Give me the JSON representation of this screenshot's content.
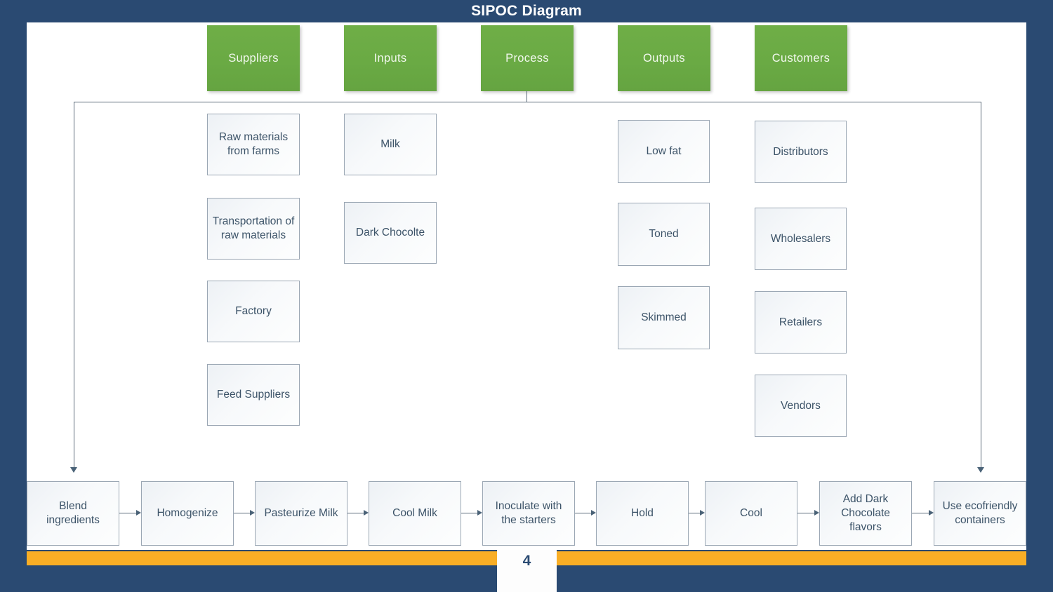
{
  "slide": {
    "title": "SIPOC Diagram",
    "page_number": "4",
    "colors": {
      "background": "#2A4A72",
      "canvas": "#FFFFFF",
      "header_green": "#6AAA44",
      "accent_orange": "#F9AE25",
      "card_border": "#9BA7B4",
      "card_text": "#3C5368",
      "connector": "#5C6B7A"
    }
  },
  "headers": [
    {
      "label": "Suppliers"
    },
    {
      "label": "Inputs"
    },
    {
      "label": "Process"
    },
    {
      "label": "Outputs"
    },
    {
      "label": "Customers"
    }
  ],
  "columns": {
    "suppliers": [
      {
        "label": "Raw materials from farms"
      },
      {
        "label": "Transportation of raw materials"
      },
      {
        "label": "Factory"
      },
      {
        "label": "Feed Suppliers"
      }
    ],
    "inputs": [
      {
        "label": "Milk"
      },
      {
        "label": "Dark Chocolte"
      }
    ],
    "outputs": [
      {
        "label": "Low fat"
      },
      {
        "label": "Toned"
      },
      {
        "label": "Skimmed"
      }
    ],
    "customers": [
      {
        "label": "Distributors"
      },
      {
        "label": "Wholesalers"
      },
      {
        "label": "Retailers"
      },
      {
        "label": "Vendors"
      }
    ]
  },
  "process_flow": [
    {
      "label": "Blend ingredients"
    },
    {
      "label": "Homogenize"
    },
    {
      "label": "Pasteurize Milk"
    },
    {
      "label": "Cool Milk"
    },
    {
      "label": "Inoculate with the starters"
    },
    {
      "label": "Hold"
    },
    {
      "label": "Cool"
    },
    {
      "label": "Add Dark Chocolate flavors"
    },
    {
      "label": "Use ecofriendly containers"
    }
  ]
}
